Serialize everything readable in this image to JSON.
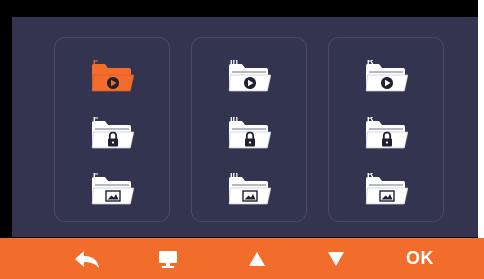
{
  "colors": {
    "accent": "#f26c2c",
    "panel": "#343450",
    "icon": "#ffffff",
    "bezel": "#000000"
  },
  "folder_groups": [
    {
      "badge": "F",
      "items": [
        {
          "type": "video",
          "icon": "folder-video-icon",
          "selected": true
        },
        {
          "type": "locked",
          "icon": "folder-lock-icon",
          "selected": false
        },
        {
          "type": "photo",
          "icon": "folder-photo-icon",
          "selected": false
        }
      ]
    },
    {
      "badge": "In",
      "items": [
        {
          "type": "video",
          "icon": "folder-video-icon",
          "selected": false
        },
        {
          "type": "locked",
          "icon": "folder-lock-icon",
          "selected": false
        },
        {
          "type": "photo",
          "icon": "folder-photo-icon",
          "selected": false
        }
      ]
    },
    {
      "badge": "R",
      "items": [
        {
          "type": "video",
          "icon": "folder-video-icon",
          "selected": false
        },
        {
          "type": "locked",
          "icon": "folder-lock-icon",
          "selected": false
        },
        {
          "type": "photo",
          "icon": "folder-photo-icon",
          "selected": false
        }
      ]
    }
  ],
  "toolbar": {
    "back_icon": "back-arrow-icon",
    "menu_icon": "monitor-icon",
    "up_icon": "triangle-up-icon",
    "down_icon": "triangle-down-icon",
    "ok_label": "OK"
  }
}
